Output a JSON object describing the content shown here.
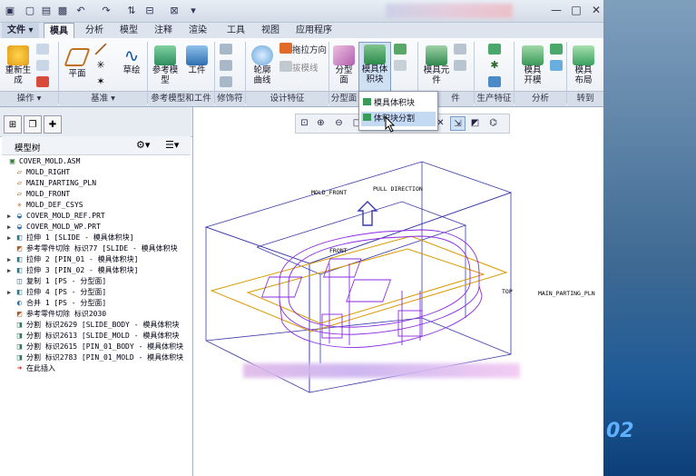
{
  "ribbon_tabs": [
    "文件",
    "模具",
    "分析",
    "模型",
    "注释",
    "渲染",
    "工具",
    "视图",
    "应用程序"
  ],
  "active_tab": "模具",
  "tools": {
    "regenerate": "重新生\n成",
    "plane": "平面",
    "sketch": "草绘",
    "ref_model": "参考模\n型",
    "workpiece": "工件",
    "contour": "轮廓\n曲线",
    "draw_direction": "拖拉方向",
    "cut_line": "拔模线",
    "parting_surface": "分型\n面",
    "mold_volume": "模具体\n积块",
    "mold_component": "模具元\n件",
    "mold_open": "模具\n开模",
    "mold_layout": "模具\n布局"
  },
  "groups": [
    "操作",
    "基准",
    "参考模型和工件",
    "修饰符",
    "设计特征",
    "分型面",
    "件",
    "生产特征",
    "分析",
    "转到"
  ],
  "dropdown": {
    "items": [
      "模具体积块",
      "体积块分割"
    ],
    "highlighted": 1
  },
  "model_tree": {
    "title": "模型树",
    "items": [
      {
        "label": "COVER_MOLD.ASM",
        "indent": 0,
        "icon": "assembly-icon",
        "exp": ""
      },
      {
        "label": "MOLD_RIGHT",
        "indent": 1,
        "icon": "datum-plane-icon",
        "exp": ""
      },
      {
        "label": "MAIN_PARTING_PLN",
        "indent": 1,
        "icon": "datum-plane-icon",
        "exp": ""
      },
      {
        "label": "MOLD_FRONT",
        "indent": 1,
        "icon": "datum-plane-icon",
        "exp": ""
      },
      {
        "label": "MOLD_DEF_CSYS",
        "indent": 1,
        "icon": "csys-icon",
        "exp": ""
      },
      {
        "label": "COVER_MOLD_REF.PRT",
        "indent": 1,
        "icon": "part-icon",
        "exp": "▶"
      },
      {
        "label": "COVER_MOLD_WP.PRT",
        "indent": 1,
        "icon": "part-icon",
        "exp": "▶"
      },
      {
        "label": "拉伸 1 [SLIDE - 模具体积块]",
        "indent": 1,
        "icon": "extrude-icon",
        "exp": "▶"
      },
      {
        "label": "参考零件切除 标识77 [SLIDE - 模具体积块",
        "indent": 1,
        "icon": "cut-icon",
        "exp": ""
      },
      {
        "label": "拉伸 2 [PIN_01 - 模具体积块]",
        "indent": 1,
        "icon": "extrude-icon",
        "exp": "▶"
      },
      {
        "label": "拉伸 3 [PIN_02 - 模具体积块]",
        "indent": 1,
        "icon": "extrude-icon",
        "exp": "▶"
      },
      {
        "label": "复制 1 [PS - 分型面]",
        "indent": 1,
        "icon": "copy-icon",
        "exp": ""
      },
      {
        "label": "拉伸 4 [PS - 分型面]",
        "indent": 1,
        "icon": "extrude-icon",
        "exp": "▶"
      },
      {
        "label": "合并 1 [PS - 分型面]",
        "indent": 1,
        "icon": "merge-icon",
        "exp": ""
      },
      {
        "label": "参考零件切除 标识2030",
        "indent": 1,
        "icon": "cut-icon",
        "exp": ""
      },
      {
        "label": "分割 标识2629 [SLIDE_BODY - 模具体积块",
        "indent": 1,
        "icon": "split-icon",
        "exp": ""
      },
      {
        "label": "分割 标识2613 [SLIDE_MOLD - 模具体积块",
        "indent": 1,
        "icon": "split-icon",
        "exp": ""
      },
      {
        "label": "分割 标识2615 [PIN_01_BODY - 模具体积块",
        "indent": 1,
        "icon": "split-icon",
        "exp": ""
      },
      {
        "label": "分割 标识2783 [PIN_01_MOLD - 模具体积块",
        "indent": 1,
        "icon": "split-icon",
        "exp": ""
      },
      {
        "label": "在此插入",
        "indent": 1,
        "icon": "insert-here-icon",
        "exp": ""
      }
    ]
  },
  "viewport_labels": {
    "mold_front": "MOLD_FRONT",
    "pull_direction": "PULL DIRECTION",
    "front": "FRONT",
    "top": "TOP",
    "main_parting_pln": "MAIN_PARTING_PLN"
  },
  "desktop_text": "02",
  "colors": {
    "accent": "#2b6cb0",
    "tree_bg": "#ffffff",
    "mold_outline": "#3a3ab0",
    "parting": "#e0a000",
    "part": "#8a2be2"
  }
}
